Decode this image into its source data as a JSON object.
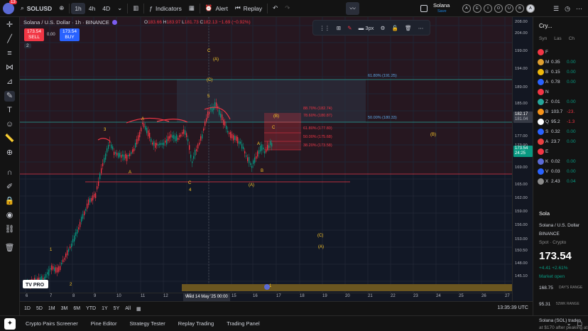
{
  "topbar": {
    "notif_count": "13",
    "symbol": "SOLUSD",
    "intervals": [
      "1h",
      "4h",
      "4D"
    ],
    "indicators_label": "Indicators",
    "alert_label": "Alert",
    "replay_label": "Replay",
    "layout_name": "Solana",
    "layout_sub": "Save",
    "circle_letters": [
      "A",
      "E",
      "I",
      "O",
      "U",
      "B",
      "A"
    ]
  },
  "chart": {
    "title": "Solana / U.S. Dollar · 1h · BINANCE",
    "ohlc": {
      "o": "183.66",
      "h": "183.97",
      "l": "181.73",
      "c": "182.13",
      "chg": "−1.69 (−0.92%)"
    },
    "sell_price": "173.54",
    "sell_label": "SELL",
    "buy_price": "173.54",
    "buy_label": "BUY",
    "spread": "0.00",
    "interval_badge": "2",
    "stroke_label": "3px",
    "colors": {
      "up": "#089981",
      "down": "#f23645",
      "bg": "#131722",
      "fib": "#26a69a",
      "wave": "#ffca28"
    }
  },
  "fib": {
    "top_label": "61.80% (191.25)",
    "mid_label": "50.00% (180.33)",
    "right_levels": [
      "88.70% (182.74)",
      "78.60% (180.87)",
      "61.80% (177.80)",
      "50.00% (175.68)",
      "38.20% (173.58)"
    ]
  },
  "waves": {
    "labels": [
      "1",
      "2",
      "3",
      "A",
      "A",
      "C",
      "4",
      "5",
      "A",
      "B",
      "(A)",
      "(B)",
      "C",
      "(B)",
      "(C)",
      "(A)",
      "C",
      "(A)",
      "1",
      "(C)"
    ]
  },
  "price_axis": {
    "labels": [
      "208.00",
      "204.00",
      "199.00",
      "194.00",
      "189.00",
      "185.00",
      "177.00",
      "173.00",
      "169.00",
      "165.00",
      "162.00",
      "159.00",
      "156.00",
      "153.00",
      "150.50",
      "148.00",
      "145.10"
    ],
    "tag_current": "182.17",
    "tag_current_sub": "181.04",
    "tag_last": "173.54",
    "tag_last_sub": "24:25"
  },
  "time_axis": {
    "labels": [
      "6",
      "7",
      "8",
      "9",
      "10",
      "11",
      "12",
      "13",
      "15",
      "16",
      "17",
      "18",
      "19",
      "20",
      "21",
      "22",
      "23",
      "24",
      "25",
      "26",
      "27"
    ],
    "crosshair_tag": "Wed 14 May '25   00:00"
  },
  "range_bar": {
    "ranges": [
      "1D",
      "5D",
      "1M",
      "3M",
      "6M",
      "YTD",
      "1Y",
      "5Y",
      "All"
    ],
    "clock": "13:35:39 UTC"
  },
  "bottom_tabs": [
    "Crypto Pairs Screener",
    "Pine Editor",
    "Strategy Tester",
    "Replay Trading",
    "Trading Panel"
  ],
  "watchlist": {
    "title": "Cry...",
    "cols": [
      "Syn",
      "Las",
      "Ch"
    ],
    "rows": [
      {
        "sym": "F",
        "last": "",
        "ch": "",
        "color": "#f23645",
        "neg": false
      },
      {
        "sym": "M",
        "last": "0.35",
        "ch": "0.00",
        "color": "#e0a030",
        "neg": false
      },
      {
        "sym": "B",
        "last": "0.15",
        "ch": "0.00",
        "color": "#f0b90b",
        "neg": false
      },
      {
        "sym": "A",
        "last": "0.78",
        "ch": "0.00",
        "color": "#2962ff",
        "neg": false
      },
      {
        "sym": "N",
        "last": "",
        "ch": "",
        "color": "#f23645",
        "neg": false
      },
      {
        "sym": "Z",
        "last": "0.01",
        "ch": "0.00",
        "color": "#26a69a",
        "neg": false
      },
      {
        "sym": "B",
        "last": "103.7",
        "ch": "-23.",
        "color": "#f7931a",
        "neg": true
      },
      {
        "sym": "Q",
        "last": "95.2",
        "ch": "-1.3",
        "color": "#ffffff",
        "neg": true
      },
      {
        "sym": "S",
        "last": "0.32",
        "ch": "0.00",
        "color": "#2962ff",
        "neg": false
      },
      {
        "sym": "A",
        "last": "23.7",
        "ch": "0.00",
        "color": "#e84142",
        "neg": false
      },
      {
        "sym": "E",
        "last": "",
        "ch": "",
        "color": "#f23645",
        "neg": false
      },
      {
        "sym": "K",
        "last": "0.02",
        "ch": "0.00",
        "color": "#5b6bd6",
        "neg": false
      },
      {
        "sym": "V",
        "last": "0.03",
        "ch": "0.00",
        "color": "#2962ff",
        "neg": false
      },
      {
        "sym": "X",
        "last": "2.43",
        "ch": "0.04",
        "color": "#8c8c8c",
        "neg": false
      }
    ]
  },
  "details": {
    "name": "Sola",
    "full": "Solana / U.S. Dollar",
    "exchange": "BINANCE",
    "type": "Spot · Crypto",
    "price": "173.54",
    "change": "+4.41  +2.61%",
    "status": "Market open",
    "range_low": "168.75",
    "range_label": "DAY'S RANGE",
    "wk_low": "95.31",
    "wk_label": "52WK RANGE",
    "news": "Solana (SOL) trades",
    "news2": "at $170 after peaking at"
  }
}
